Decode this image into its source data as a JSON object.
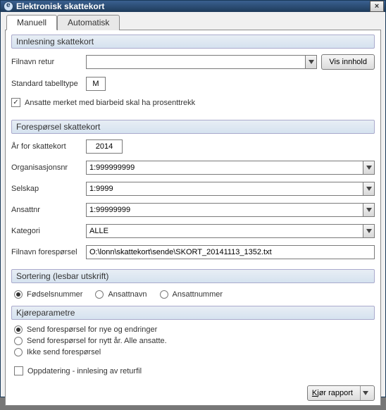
{
  "window": {
    "title": "Elektronisk skattekort",
    "close": "×"
  },
  "tabs": {
    "manuell": "Manuell",
    "automatisk": "Automatisk"
  },
  "innlesning": {
    "heading": "Innlesning skattekort",
    "filnavn_retur_label": "Filnavn retur",
    "filnavn_retur_value": "",
    "vis_innhold": "Vis innhold",
    "standard_tabelltype_label": "Standard tabelltype",
    "standard_tabelltype_value": "M",
    "checkbox_label": "Ansatte merket med biarbeid skal ha prosenttrekk",
    "checkbox_checked": "✓"
  },
  "foresporsel": {
    "heading": "Forespørsel skattekort",
    "aar_label": "År for skattekort",
    "aar_value": "2014",
    "orgnr_label": "Organisasjonsnr",
    "orgnr_value": "1:999999999",
    "selskap_label": "Selskap",
    "selskap_value": "1:9999",
    "ansattnr_label": "Ansattnr",
    "ansattnr_value": "1:99999999",
    "kategori_label": "Kategori",
    "kategori_value": "ALLE",
    "filnavn_label": "Filnavn forespørsel",
    "filnavn_value": "O:\\lonn\\skattekort\\sende\\SKORT_20141113_1352.txt"
  },
  "sortering": {
    "heading": "Sortering (lesbar utskrift)",
    "fodselsnummer": "Fødselsnummer",
    "ansattnavn": "Ansattnavn",
    "ansattnummer": "Ansattnummer"
  },
  "kjoreparam": {
    "heading": "Kjøreparametre",
    "opt1": "Send forespørsel for nye og endringer",
    "opt2": "Send forespørsel for nytt år. Alle ansatte.",
    "opt3": "Ikke send forespørsel",
    "oppdatering": "Oppdatering - innlesing av returfil"
  },
  "footer": {
    "kjor_rapport_pre": "K",
    "kjor_rapport_rest": "jør rapport"
  }
}
